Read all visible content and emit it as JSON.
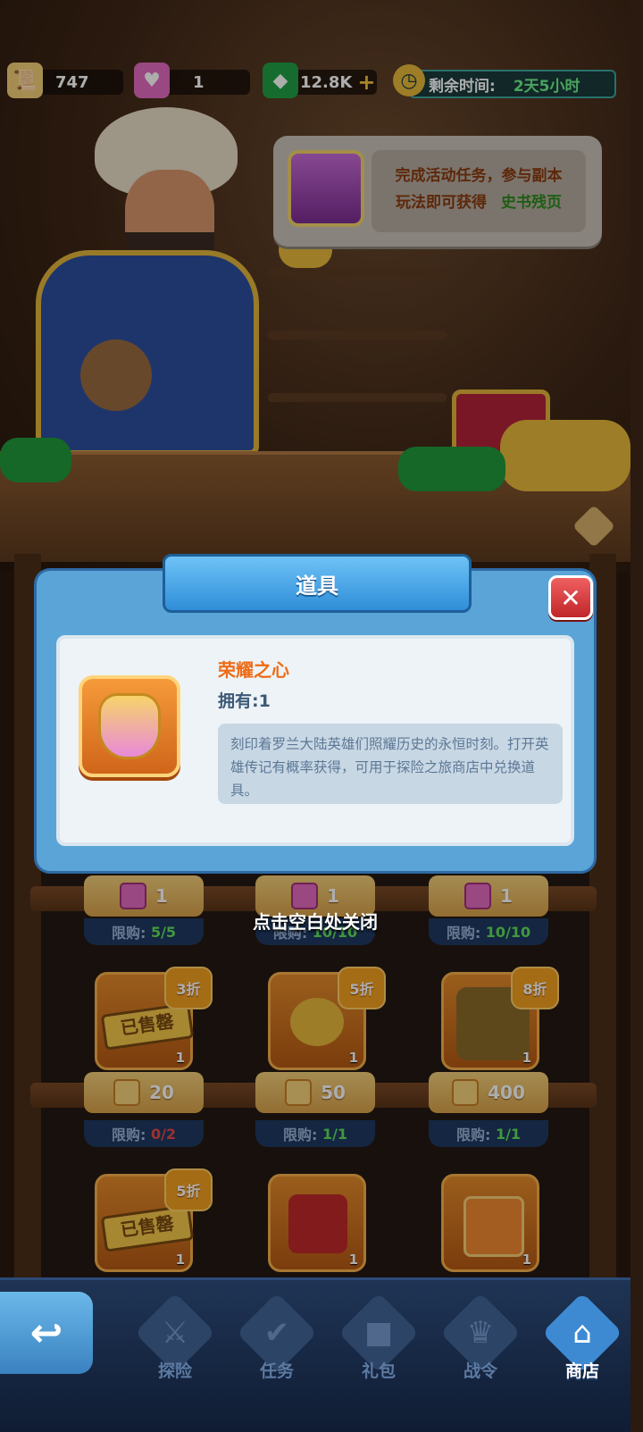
{
  "topbar": {
    "scroll": {
      "icon": "history-scroll-icon",
      "value": "747"
    },
    "heart": {
      "icon": "glory-heart-icon",
      "value": "1"
    },
    "gem": {
      "icon": "green-gem-icon",
      "value": "12.8K",
      "add": "+"
    },
    "timer": {
      "icon": "stopwatch-icon",
      "label": "剩余时间:",
      "value": "2天5小时"
    }
  },
  "merchant_bubble": {
    "line1": "完成活动任务，参与副本",
    "line2_prefix": "玩法即可获得",
    "line2_highlight": "史书残页"
  },
  "modal": {
    "title": "道具",
    "close": "✕",
    "item_name": "荣耀之心",
    "owned": "拥有:1",
    "description": "刻印着罗兰大陆英雄们照耀历史的永恒时刻。打开英雄传记有概率获得，可用于探险之旅商店中兑换道具。"
  },
  "close_hint": "点击空白处关闭",
  "shop": {
    "row1": [
      {
        "price": "1",
        "limit_label": "限购:",
        "limit": "5/5"
      },
      {
        "price": "1",
        "limit_label": "限购:",
        "limit": "10/10"
      },
      {
        "price": "1",
        "limit_label": "限购:",
        "limit": "10/10"
      }
    ],
    "row2": [
      {
        "discount": "3折",
        "sold": "已售罄",
        "qty": "1",
        "price": "20",
        "limit_label": "限购:",
        "limit": "0/2"
      },
      {
        "discount": "5折",
        "qty": "1",
        "price": "50",
        "limit_label": "限购:",
        "limit": "1/1"
      },
      {
        "discount": "8折",
        "qty": "1",
        "price": "400",
        "limit_label": "限购:",
        "limit": "1/1"
      }
    ],
    "row3": [
      {
        "discount": "5折",
        "sold": "已售罄",
        "qty": "1"
      },
      {
        "qty": "1"
      },
      {
        "qty": "1"
      }
    ]
  },
  "nav": {
    "back": "↩",
    "tabs": [
      {
        "label": "探险",
        "icon": "crossed-swords-icon"
      },
      {
        "label": "任务",
        "icon": "task-scroll-icon"
      },
      {
        "label": "礼包",
        "icon": "gift-icon"
      },
      {
        "label": "战令",
        "icon": "shield-crown-icon"
      },
      {
        "label": "商店",
        "icon": "shop-icon"
      }
    ]
  }
}
